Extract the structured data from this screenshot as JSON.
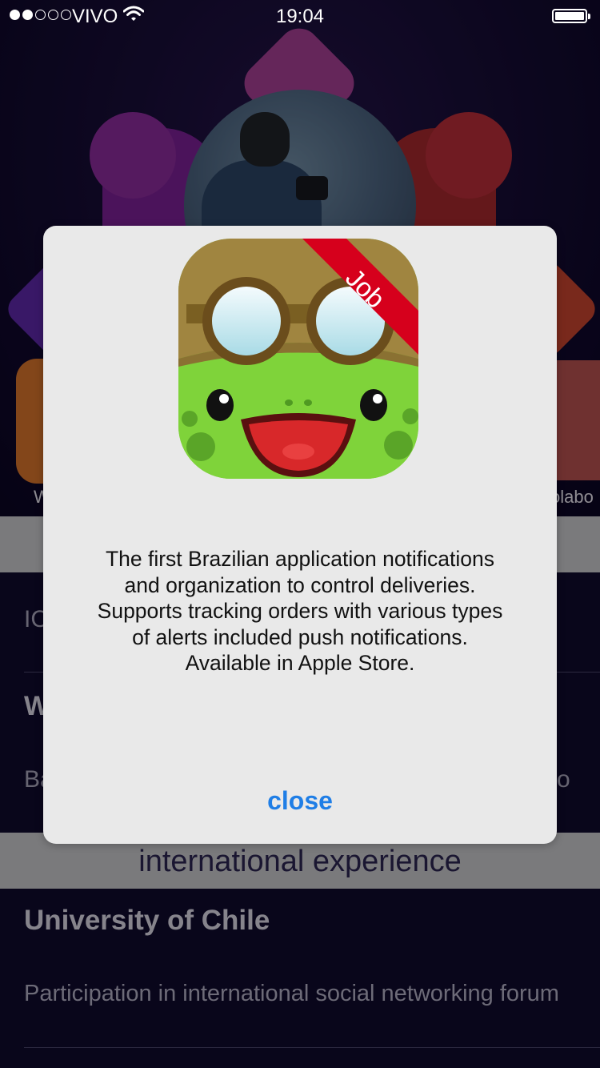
{
  "status_bar": {
    "carrier": "VIVO",
    "time": "19:04",
    "signal_bars_filled": 2,
    "signal_bars_total": 5,
    "battery_level": 1.0
  },
  "background": {
    "tile_left_label": "W",
    "tile_right_label": "olabo",
    "list_item_1_partial": "IC",
    "list_item_2_partial": "W",
    "list_item_3_partial": "Ba",
    "list_item_3_trailing": "o",
    "section_title": "international experience",
    "university_title": "University of Chile",
    "university_desc": "Participation in international social networking forum"
  },
  "modal": {
    "icon_ribbon_text": "Job",
    "icon_name": "frog-aviator-app-icon",
    "description_lines": [
      "The first Brazilian application notifications",
      "and organization to control deliveries.",
      "Supports tracking orders with various types",
      "of alerts included push notifications.",
      "Available in Apple Store."
    ],
    "close_label": "close"
  },
  "colors": {
    "accent": "#1f7ee6",
    "modal_bg": "#e9e9e9",
    "page_bg": "#0b0625",
    "ribbon": "#d6001c"
  }
}
